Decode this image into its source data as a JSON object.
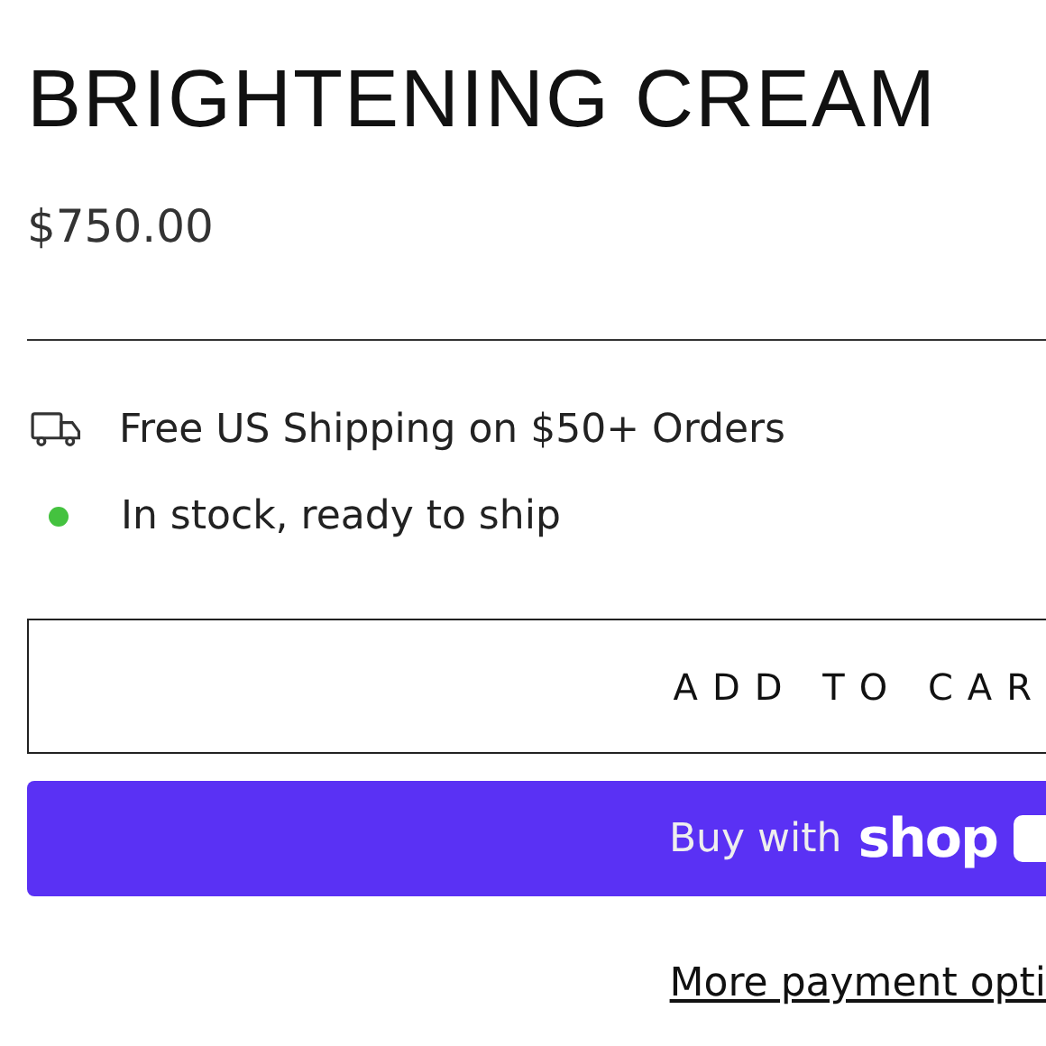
{
  "product": {
    "title": "BRIGHTENING CREAM",
    "price": "$750.00"
  },
  "notes": [
    {
      "kind": "shipping",
      "text": "Free US Shipping on $50+ Orders"
    },
    {
      "kind": "stock",
      "text": "In stock, ready to ship",
      "color": "#44c23f"
    }
  ],
  "buttons": {
    "add_to_cart": "ADD TO CAR",
    "buy_with": "Buy with",
    "buy_brand": "shop",
    "more_payment": "More payment opti"
  }
}
